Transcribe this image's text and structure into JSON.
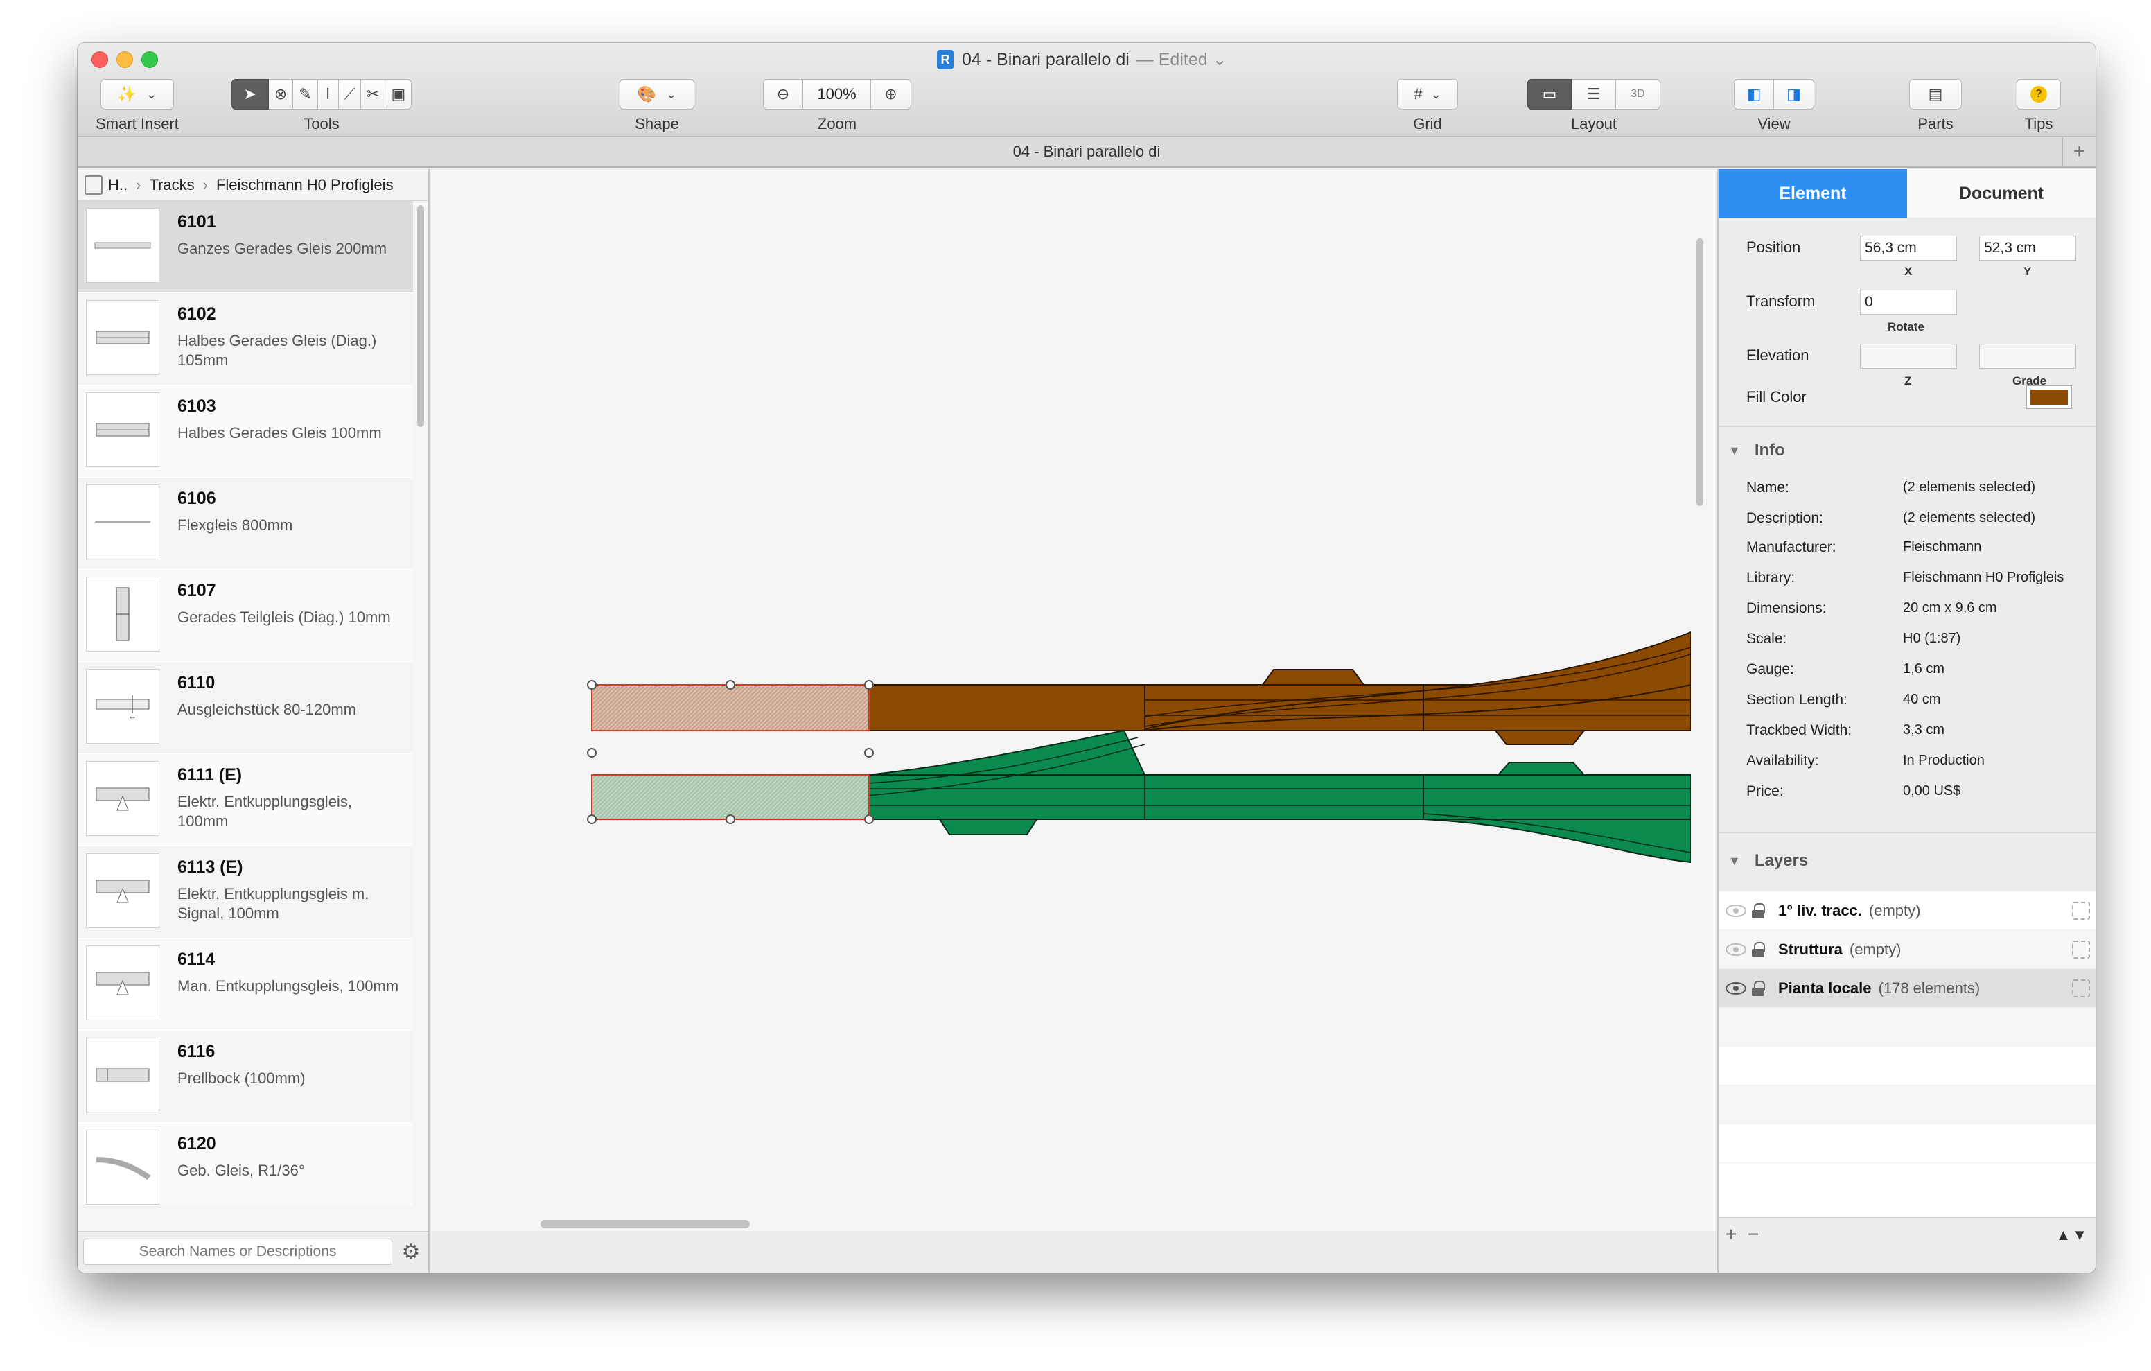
{
  "window": {
    "title": "04 - Binari parallelo di",
    "edited": "— Edited ⌄",
    "doc_icon": "R",
    "tab_title": "04 - Binari parallelo di"
  },
  "toolbar": {
    "smart_insert_label": "Smart Insert",
    "tools_label": "Tools",
    "shape_label": "Shape",
    "zoom_label": "Zoom",
    "zoom_value": "100%",
    "grid_label": "Grid",
    "layout_label": "Layout",
    "view_label": "View",
    "parts_label": "Parts",
    "tips_label": "Tips"
  },
  "library": {
    "breadcrumb": [
      "H..",
      "Tracks",
      "Fleischmann H0 Profigleis"
    ],
    "items": [
      {
        "code": "6101",
        "desc": "Ganzes Gerades Gleis 200mm"
      },
      {
        "code": "6102",
        "desc": "Halbes Gerades Gleis (Diag.) 105mm"
      },
      {
        "code": "6103",
        "desc": "Halbes Gerades Gleis 100mm"
      },
      {
        "code": "6106",
        "desc": "Flexgleis 800mm"
      },
      {
        "code": "6107",
        "desc": "Gerades Teilgleis (Diag.) 10mm"
      },
      {
        "code": "6110",
        "desc": "Ausgleichstück 80-120mm"
      },
      {
        "code": "6111 (E)",
        "desc": "Elektr. Entkupplungsgleis, 100mm"
      },
      {
        "code": "6113 (E)",
        "desc": "Elektr. Entkupplungsgleis m. Signal, 100mm"
      },
      {
        "code": "6114",
        "desc": "Man. Entkupplungsgleis, 100mm"
      },
      {
        "code": "6116",
        "desc": "Prellbock (100mm)"
      },
      {
        "code": "6120",
        "desc": "Geb. Gleis, R1/36°"
      }
    ],
    "search_placeholder": "Search Names or Descriptions"
  },
  "inspector": {
    "tab_element": "Element",
    "tab_document": "Document",
    "position_label": "Position",
    "position_x": "56,3 cm",
    "position_y": "52,3 cm",
    "x_label": "X",
    "y_label": "Y",
    "transform_label": "Transform",
    "rotate_value": "0",
    "rotate_label": "Rotate",
    "elevation_label": "Elevation",
    "z_label": "Z",
    "grade_label": "Grade",
    "fill_color_label": "Fill Color",
    "fill_color": "#8b4a00",
    "info_title": "Info",
    "info": [
      {
        "key": "Name:",
        "value": "(2 elements selected)"
      },
      {
        "key": "Description:",
        "value": "(2 elements selected)"
      },
      {
        "key": "Manufacturer:",
        "value": "Fleischmann"
      },
      {
        "key": "Library:",
        "value": "Fleischmann H0 Profigleis"
      },
      {
        "key": "Dimensions:",
        "value": "20 cm x 9,6 cm"
      },
      {
        "key": "Scale:",
        "value": "H0  (1:87)"
      },
      {
        "key": "Gauge:",
        "value": "1,6 cm"
      },
      {
        "key": "Section Length:",
        "value": "40 cm"
      },
      {
        "key": "Trackbed Width:",
        "value": "3,3 cm"
      },
      {
        "key": "Availability:",
        "value": "In Production"
      },
      {
        "key": "Price:",
        "value": "0,00 US$"
      }
    ],
    "layers_title": "Layers",
    "layers": [
      {
        "name": "1° liv. tracc.",
        "count": "(empty)",
        "visible": false
      },
      {
        "name": "Struttura",
        "count": "(empty)",
        "visible": false
      },
      {
        "name": "Pianta locale",
        "count": "(178 elements)",
        "visible": true
      }
    ]
  },
  "colors": {
    "track_brown": "#8b4a00",
    "track_green": "#0b8a4f",
    "accent_blue": "#2d8ef0"
  }
}
